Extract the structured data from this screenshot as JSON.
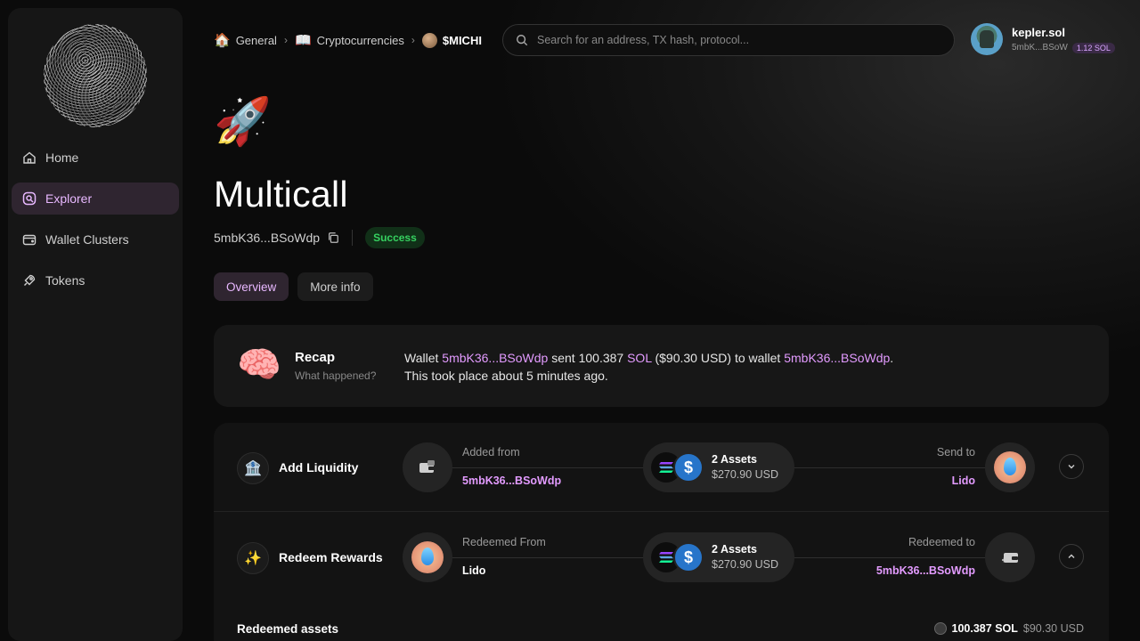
{
  "sidebar": {
    "items": [
      {
        "label": "Home",
        "icon": "home-icon"
      },
      {
        "label": "Explorer",
        "icon": "explorer-icon",
        "active": true
      },
      {
        "label": "Wallet Clusters",
        "icon": "wallet-icon"
      },
      {
        "label": "Tokens",
        "icon": "rocket-icon"
      }
    ]
  },
  "breadcrumb": {
    "items": [
      {
        "emoji": "🏠",
        "label": "General"
      },
      {
        "emoji": "📖",
        "label": "Cryptocurrencies"
      },
      {
        "label": "$MICHI"
      }
    ]
  },
  "search": {
    "placeholder": "Search for an address, TX hash, protocol..."
  },
  "user": {
    "name": "kepler.sol",
    "address": "5mbK...BSoW",
    "balance": "1.12 SOL"
  },
  "header": {
    "emoji": "🚀",
    "title": "Multicall",
    "hash": "5mbK36...BSoWdp",
    "status": "Success"
  },
  "tabs": [
    {
      "label": "Overview",
      "active": true
    },
    {
      "label": "More info"
    }
  ],
  "recap": {
    "emoji": "🧠",
    "title": "Recap",
    "subtitle": "What happened?",
    "line1": {
      "p1": "Wallet ",
      "wallet": "5mbK36...BSoWdp",
      "p2": " sent 100.387 ",
      "token": "SOL",
      "p3": " ($90.30 USD) to wallet ",
      "wallet2": "5mbK36...BSoWdp",
      "p4": "."
    },
    "line2": "This took place about 5 minutes ago."
  },
  "actions": [
    {
      "emoji": "🏦",
      "label": "Add Liquidity",
      "from_label": "Added from",
      "from_value": "5mbK36...BSoWdp",
      "assets_count": "2 Assets",
      "assets_usd": "$270.90 USD",
      "to_label": "Send to",
      "to_value": "Lido"
    },
    {
      "emoji": "✨",
      "label": "Redeem Rewards",
      "from_label": "Redeemed From",
      "from_value": "Lido",
      "assets_count": "2 Assets",
      "assets_usd": "$270.90 USD",
      "to_label": "Redeemed to",
      "to_value": "5mbK36...BSoWdp"
    }
  ],
  "redeemed": {
    "title": "Redeemed assets",
    "amount": "100.387 SOL",
    "usd": "$90.30 USD"
  },
  "colors": {
    "accent": "#e39bff",
    "success": "#36d160",
    "active_bg": "#2f2530"
  }
}
